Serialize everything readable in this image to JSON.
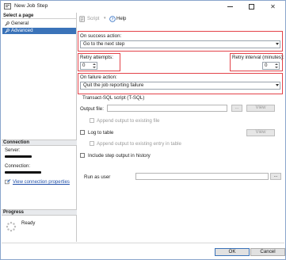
{
  "window": {
    "title": "New Job Step"
  },
  "left_pane": {
    "select_page_header": "Select a page",
    "pages": [
      {
        "label": "General",
        "selected": false
      },
      {
        "label": "Advanced",
        "selected": true
      }
    ],
    "connection": {
      "header": "Connection",
      "server_label": "Server:",
      "connection_label": "Connection:",
      "view_properties_link": "View connection properties"
    },
    "progress": {
      "header": "Progress",
      "status": "Ready"
    }
  },
  "toolbar": {
    "script_label": "Script",
    "help_label": "Help"
  },
  "form": {
    "on_success": {
      "label": "On success action:",
      "value": "Go to the next step"
    },
    "retry_attempts": {
      "label": "Retry attempts:",
      "value": "0"
    },
    "retry_interval": {
      "label": "Retry interval (minutes):",
      "value": "0"
    },
    "on_failure": {
      "label": "On failure action:",
      "value": "Quit the job reporting failure"
    },
    "tsql_section_label": "Transact-SQL script (T-SQL)",
    "output_file": {
      "label": "Output file:",
      "browse_label": "...",
      "view_label": "View"
    },
    "append_output_file": "Append output to existing file",
    "log_to_table": "Log to table",
    "log_view_label": "View",
    "append_output_table": "Append output to existing entry in table",
    "include_history": "Include step output in history",
    "run_as_user": {
      "label": "Run as user",
      "browse_label": "..."
    }
  },
  "footer": {
    "ok_label": "OK",
    "cancel_label": "Cancel"
  },
  "colors": {
    "selection": "#3b73b9",
    "highlight_box": "#e3434a",
    "link": "#1f4ea8"
  }
}
